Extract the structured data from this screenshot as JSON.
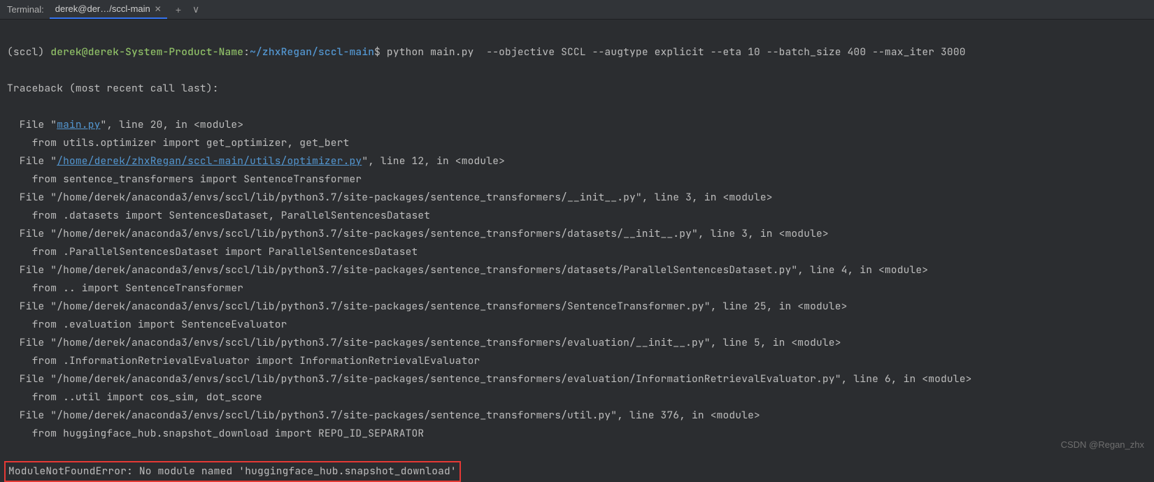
{
  "tabbar": {
    "label": "Terminal:",
    "tab_title": "derek@der…/sccl-main",
    "add_label": "+",
    "chevron_label": "∨"
  },
  "prompt": {
    "env": "(sccl)",
    "user": "derek@derek-System-Product-Name",
    "colon": ":",
    "path": "~/zhxRegan/sccl-main",
    "dollar": "$",
    "command": " python main.py  --objective SCCL --augtype explicit --eta 10 --batch_size 400 --max_iter 3000"
  },
  "traceback_header": "Traceback (most recent call last):",
  "frames": [
    {
      "pre": "  File \"",
      "link": "main.py",
      "post": "\", line 20, in <module>",
      "code": "    from utils.optimizer import get_optimizer, get_bert"
    },
    {
      "pre": "  File \"",
      "link": "/home/derek/zhxRegan/sccl-main/utils/optimizer.py",
      "post": "\", line 12, in <module>",
      "code": "    from sentence_transformers import SentenceTransformer"
    },
    {
      "plain": "  File \"/home/derek/anaconda3/envs/sccl/lib/python3.7/site-packages/sentence_transformers/__init__.py\", line 3, in <module>",
      "code": "    from .datasets import SentencesDataset, ParallelSentencesDataset"
    },
    {
      "plain": "  File \"/home/derek/anaconda3/envs/sccl/lib/python3.7/site-packages/sentence_transformers/datasets/__init__.py\", line 3, in <module>",
      "code": "    from .ParallelSentencesDataset import ParallelSentencesDataset"
    },
    {
      "plain": "  File \"/home/derek/anaconda3/envs/sccl/lib/python3.7/site-packages/sentence_transformers/datasets/ParallelSentencesDataset.py\", line 4, in <module>",
      "code": "    from .. import SentenceTransformer"
    },
    {
      "plain": "  File \"/home/derek/anaconda3/envs/sccl/lib/python3.7/site-packages/sentence_transformers/SentenceTransformer.py\", line 25, in <module>",
      "code": "    from .evaluation import SentenceEvaluator"
    },
    {
      "plain": "  File \"/home/derek/anaconda3/envs/sccl/lib/python3.7/site-packages/sentence_transformers/evaluation/__init__.py\", line 5, in <module>",
      "code": "    from .InformationRetrievalEvaluator import InformationRetrievalEvaluator"
    },
    {
      "plain": "  File \"/home/derek/anaconda3/envs/sccl/lib/python3.7/site-packages/sentence_transformers/evaluation/InformationRetrievalEvaluator.py\", line 6, in <module>",
      "code": "    from ..util import cos_sim, dot_score"
    },
    {
      "plain": "  File \"/home/derek/anaconda3/envs/sccl/lib/python3.7/site-packages/sentence_transformers/util.py\", line 376, in <module>",
      "code": "    from huggingface_hub.snapshot_download import REPO_ID_SEPARATOR"
    }
  ],
  "error_line": "ModuleNotFoundError: No module named 'huggingface_hub.snapshot_download'",
  "watermark": "CSDN @Regan_zhx"
}
